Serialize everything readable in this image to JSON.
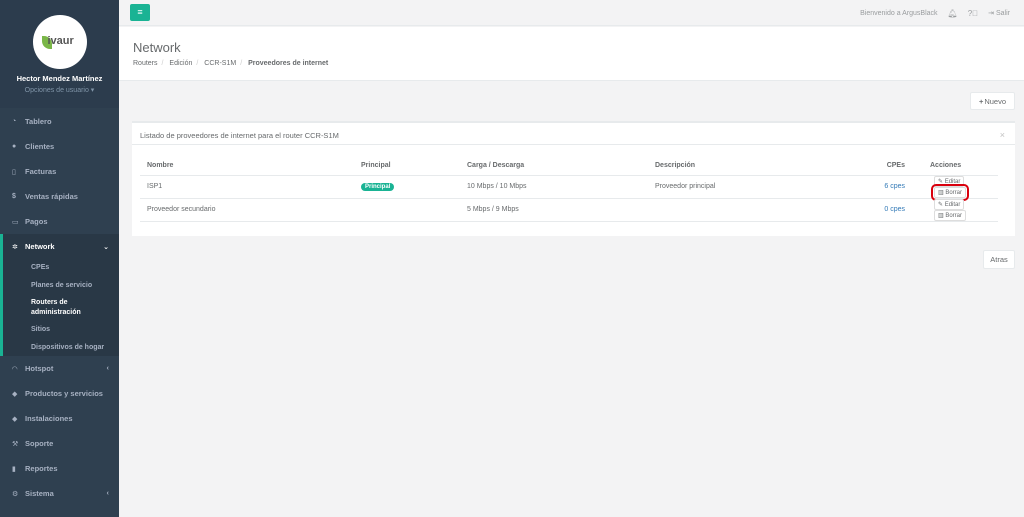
{
  "sidebar": {
    "logo_text": "ivaur",
    "user_name": "Hector Mendez Martínez",
    "user_options": "Opciones de usuario ▾",
    "items": [
      {
        "label": "Tablero",
        "icon": "dashboard-icon"
      },
      {
        "label": "Clientes",
        "icon": "users-icon"
      },
      {
        "label": "Facturas",
        "icon": "file-icon"
      },
      {
        "label": "Ventas rápidas",
        "icon": "dollar-icon"
      },
      {
        "label": "Pagos",
        "icon": "money-icon"
      },
      {
        "label": "Network",
        "icon": "network-icon"
      },
      {
        "label": "Hotspot",
        "icon": "wifi-icon"
      },
      {
        "label": "Productos y servicios",
        "icon": "tag-icon"
      },
      {
        "label": "Instalaciones",
        "icon": "tags-icon"
      },
      {
        "label": "Soporte",
        "icon": "wrench-icon"
      },
      {
        "label": "Reportes",
        "icon": "book-icon"
      },
      {
        "label": "Sistema",
        "icon": "cogs-icon"
      }
    ],
    "network_sub": [
      "CPEs",
      "Planes de servicio",
      "Routers de administración",
      "Sitios",
      "Dispositivos de hogar"
    ]
  },
  "topbar": {
    "welcome": "Bienvenido a ArgusBlack",
    "logout": "Salir"
  },
  "header": {
    "title": "Network",
    "breadcrumb": [
      "Routers",
      "Edición",
      "CCR-S1M",
      "Proveedores de internet"
    ]
  },
  "buttons": {
    "nuevo": "Nuevo",
    "atras": "Atras"
  },
  "panel": {
    "title": "Listado de proveedores de internet para el router CCR-S1M",
    "columns": [
      "Nombre",
      "Principal",
      "Carga / Descarga",
      "Descripción",
      "CPEs",
      "Acciones"
    ],
    "rows": [
      {
        "nombre": "ISP1",
        "principal": "Principal",
        "carga": "10 Mbps / 10 Mbps",
        "descripcion": "Proveedor principal",
        "cpes": "6 cpes",
        "editar": "Editar",
        "borrar": "Borrar"
      },
      {
        "nombre": "Proveedor secundario",
        "principal": "",
        "carga": "5 Mbps / 9 Mbps",
        "descripcion": "",
        "cpes": "0 cpes",
        "editar": "Editar",
        "borrar": "Borrar"
      }
    ]
  },
  "colors": {
    "accent": "#1ab394",
    "sidebar": "#2f4050",
    "highlight": "#d9000d"
  }
}
